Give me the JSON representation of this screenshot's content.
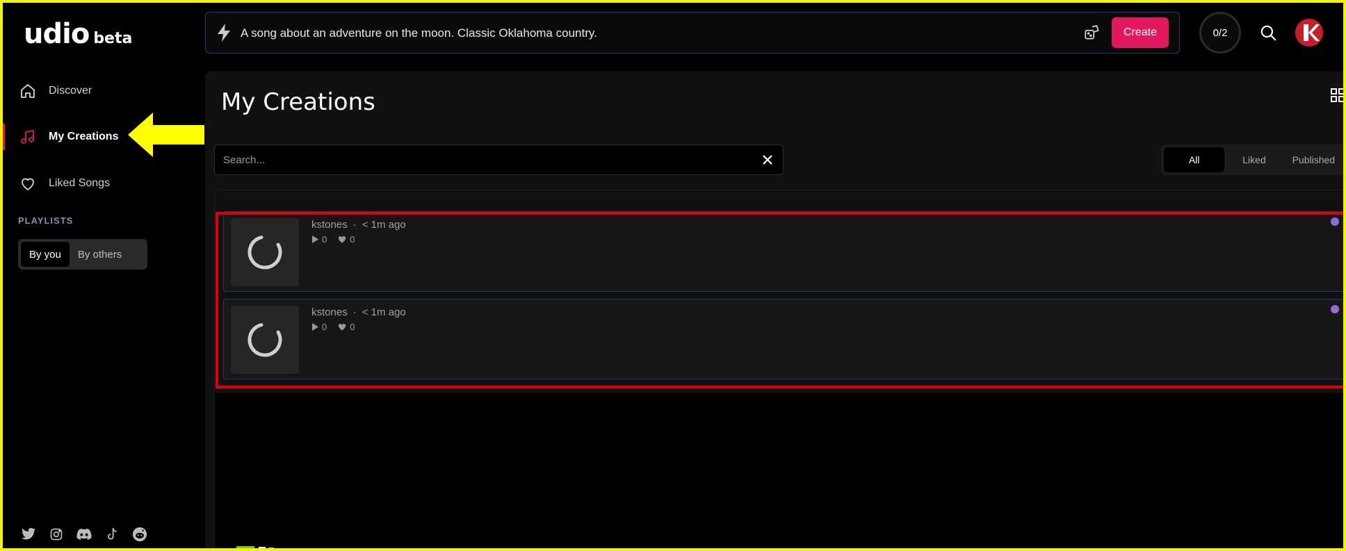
{
  "app": {
    "logo_main": "udio",
    "logo_sub": "beta"
  },
  "sidebar": {
    "items": [
      {
        "label": "Discover",
        "icon": "home-icon",
        "active": false
      },
      {
        "label": "My Creations",
        "icon": "music-note-icon",
        "active": true
      },
      {
        "label": "Liked Songs",
        "icon": "heart-icon",
        "active": false
      }
    ],
    "playlists_label": "PLAYLISTS",
    "playlist_tabs": [
      {
        "label": "By you",
        "selected": true
      },
      {
        "label": "By others",
        "selected": false
      }
    ],
    "socials": [
      "twitter-icon",
      "instagram-icon",
      "discord-icon",
      "tiktok-icon",
      "reddit-icon"
    ]
  },
  "topbar": {
    "prompt": "A song about an adventure on the moon. Classic Oklahoma country.",
    "create_label": "Create",
    "credits": "0/2"
  },
  "main": {
    "title": "My Creations",
    "search_placeholder": "Search...",
    "filters": [
      {
        "label": "All",
        "selected": true
      },
      {
        "label": "Liked",
        "selected": false
      },
      {
        "label": "Published",
        "selected": false
      }
    ],
    "songs": [
      {
        "author": "kstones",
        "separator": "·",
        "time": "< 1m ago",
        "plays": "0",
        "likes": "0"
      },
      {
        "author": "kstones",
        "separator": "·",
        "time": "< 1m ago",
        "plays": "0",
        "likes": "0"
      }
    ]
  },
  "colors": {
    "accent": "#e3195f",
    "annotation_frame": "#f3f200",
    "annotation_arrow": "#ffff00",
    "annotation_box": "#e00000",
    "status_dot": "#8f6bd6"
  }
}
